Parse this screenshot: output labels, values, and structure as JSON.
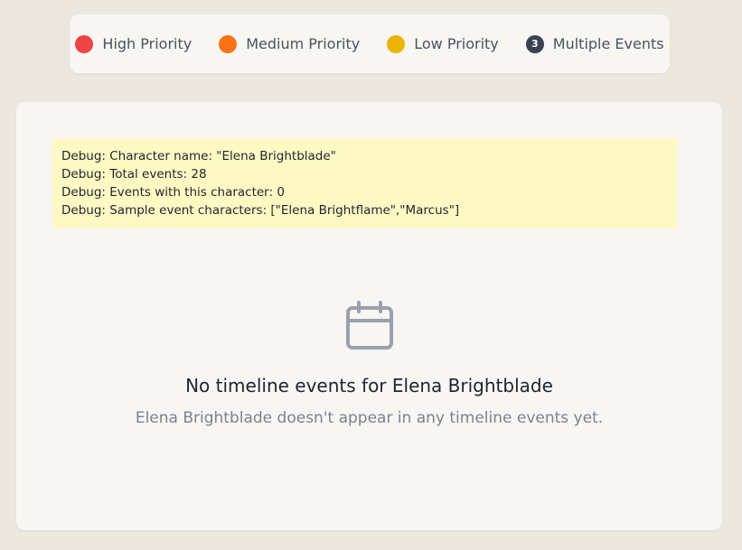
{
  "legend": {
    "items": [
      {
        "label": "High Priority",
        "color": "#ef4444"
      },
      {
        "label": "Medium Priority",
        "color": "#f97316"
      },
      {
        "label": "Low Priority",
        "color": "#eab308"
      }
    ],
    "multiple": {
      "count": "3",
      "label": "Multiple Events",
      "color": "#3a4152"
    }
  },
  "debug": {
    "lines": [
      "Debug: Character name: \"Elena Brightblade\"",
      "Debug: Total events: 28",
      "Debug: Events with this character: 0",
      "Debug: Sample event characters: [\"Elena Brightflame\",\"Marcus\"]"
    ]
  },
  "empty_state": {
    "icon": "calendar-icon",
    "title": "No timeline events for Elena Brightblade",
    "subtitle": "Elena Brightblade doesn't appear in any timeline events yet."
  }
}
